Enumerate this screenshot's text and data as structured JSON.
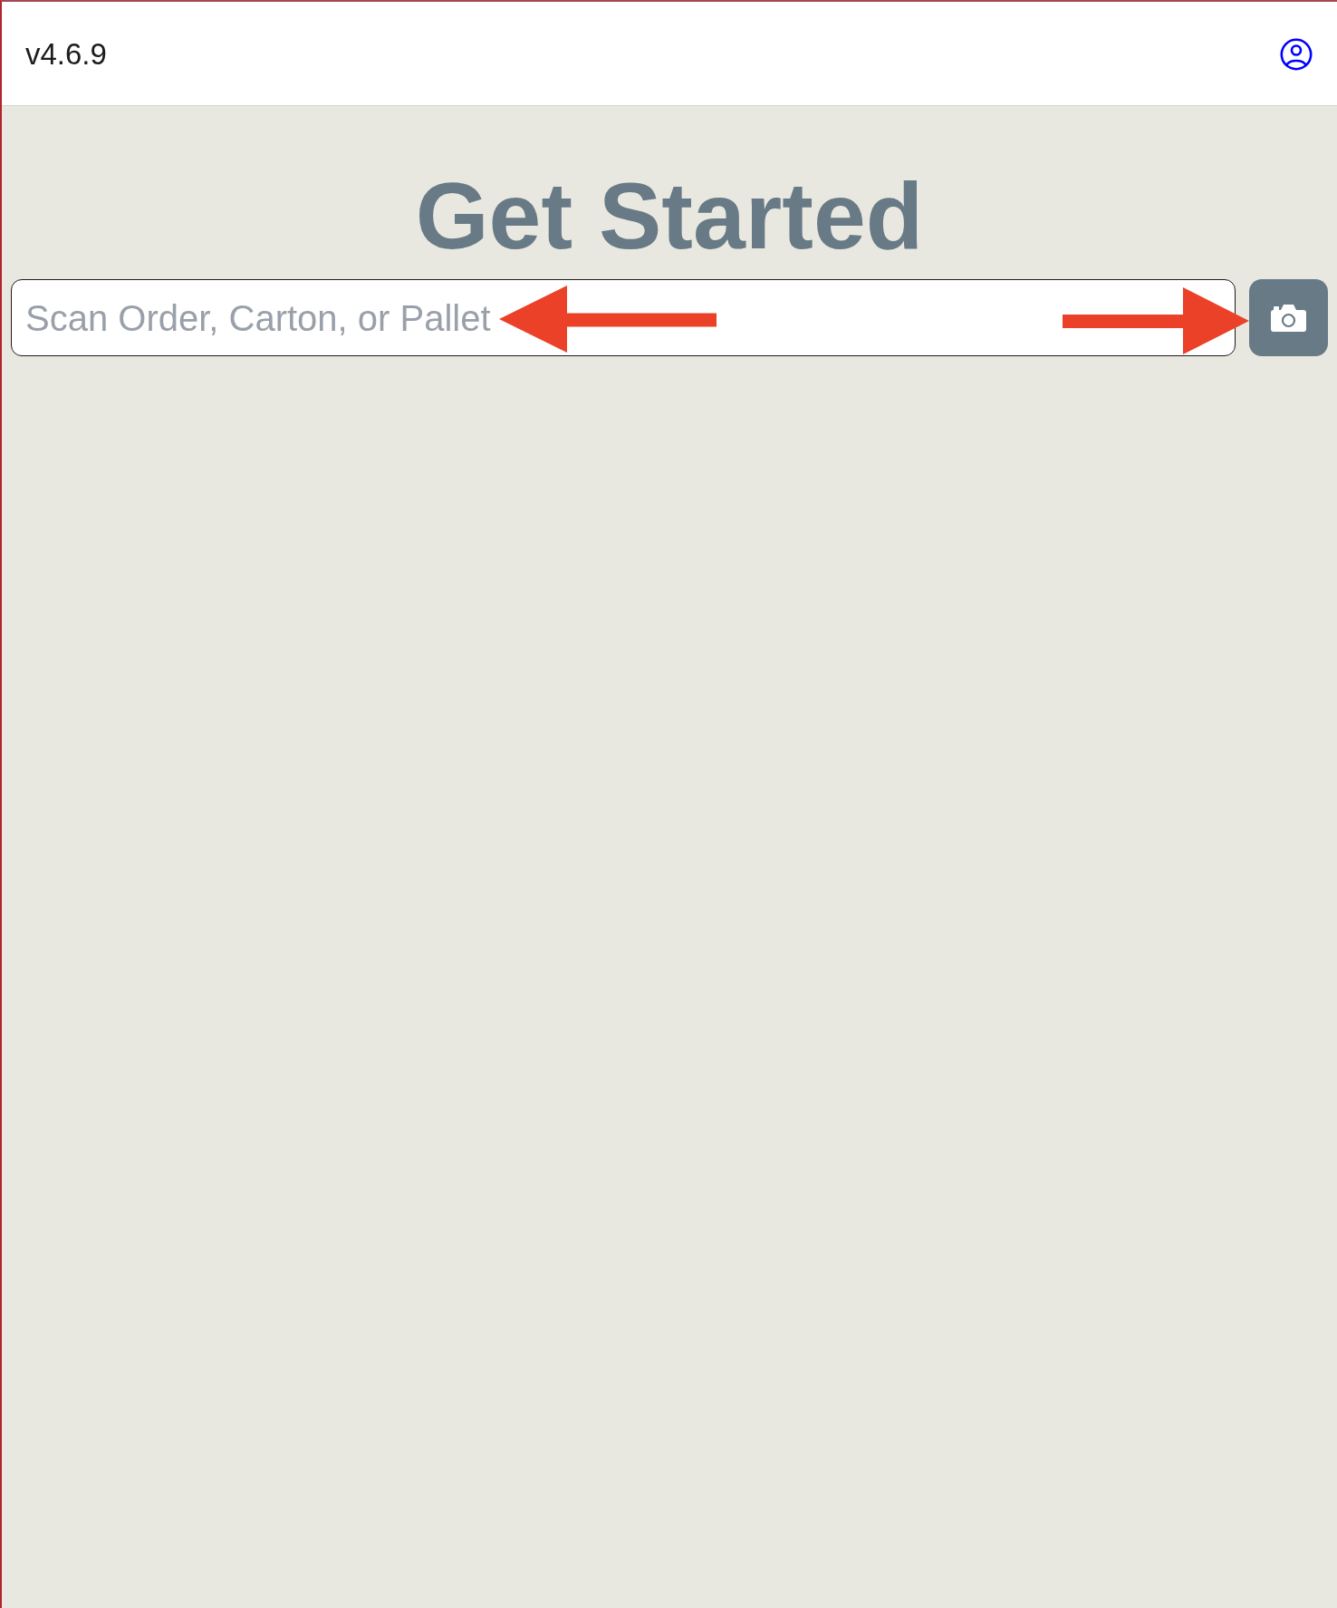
{
  "header": {
    "version": "v4.6.9"
  },
  "title": "Get Started",
  "search": {
    "placeholder": "Scan Order, Carton, or Pallet"
  },
  "annotations": [
    {
      "kind": "left_arrow"
    },
    {
      "kind": "right_arrow"
    }
  ]
}
